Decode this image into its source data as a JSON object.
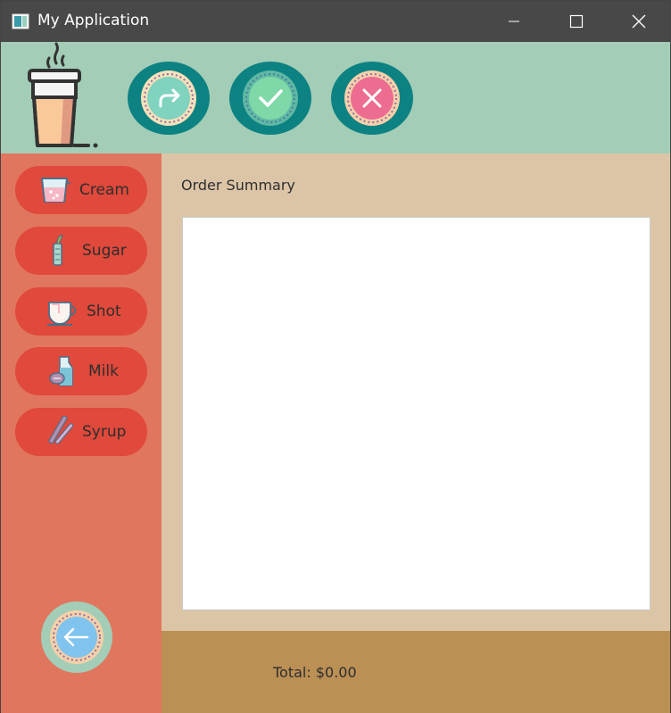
{
  "window": {
    "title": "My Application",
    "controls": [
      "minimize",
      "maximize",
      "close"
    ]
  },
  "toolbar": {
    "logo": "coffee-cup-icon",
    "buttons": [
      {
        "icon": "forward-arrow-icon",
        "color": "#f6a38a"
      },
      {
        "icon": "check-icon",
        "color": "#6fcfa5"
      },
      {
        "icon": "x-icon",
        "color": "#e8668a"
      }
    ]
  },
  "sidebar": {
    "items": [
      {
        "label": "Cream",
        "icon": "cream-icon"
      },
      {
        "label": "Sugar",
        "icon": "sugar-icon"
      },
      {
        "label": "Shot",
        "icon": "shot-cup-icon"
      },
      {
        "label": "Milk",
        "icon": "milk-carton-icon"
      },
      {
        "label": "Syrup",
        "icon": "syrup-icon"
      }
    ],
    "back_icon": "back-arrow-icon"
  },
  "main": {
    "summary_title": "Order Summary",
    "summary_content": ""
  },
  "footer": {
    "total_label": "Total: $0.00"
  },
  "colors": {
    "titlebar": "#484848",
    "header": "#a3cdb7",
    "sidebar": "#e1765e",
    "sidebar_button": "#e0493b",
    "main": "#dcc5a7",
    "footer": "#bb9055",
    "toolbar_button": "#0d8282"
  }
}
